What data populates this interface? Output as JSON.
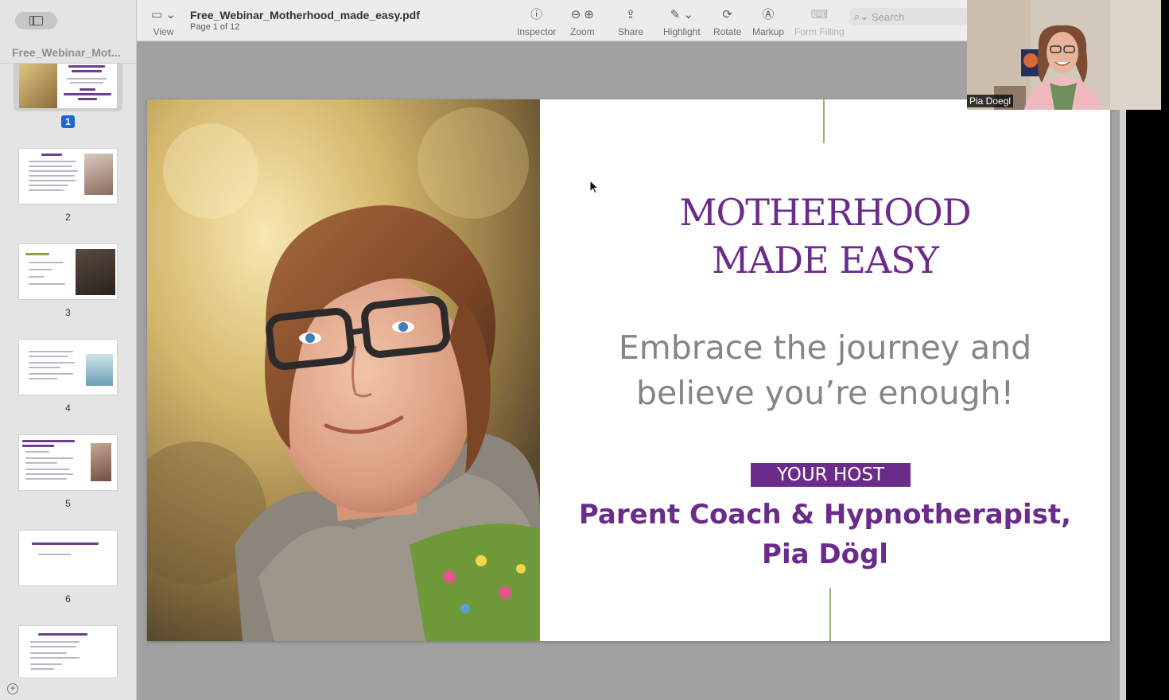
{
  "toolbar": {
    "view_label": "View",
    "doc_title": "Free_Webinar_Motherhood_made_easy.pdf",
    "page_info": "Page 1 of 12",
    "inspector_label": "Inspector",
    "zoom_label": "Zoom",
    "share_label": "Share",
    "highlight_label": "Highlight",
    "rotate_label": "Rotate",
    "markup_label": "Markup",
    "form_filling_label": "Form Filling",
    "search_placeholder": "Search"
  },
  "sidebar": {
    "title": "Free_Webinar_Mot...",
    "pages": [
      {
        "number": "1",
        "selected": true
      },
      {
        "number": "2"
      },
      {
        "number": "3"
      },
      {
        "number": "4"
      },
      {
        "number": "5"
      },
      {
        "number": "6"
      }
    ]
  },
  "slide": {
    "title_line1": "MOTHERHOOD",
    "title_line2": "MADE EASY",
    "tagline_line1": "Embrace the journey and",
    "tagline_line2": "believe you’re enough!",
    "host_badge": "YOUR HOST",
    "host_line1": "Parent Coach & Hypnotherapist,",
    "host_line2": "Pia Dögl",
    "accent_color": "#6a2b8a",
    "tagline_color": "#858585",
    "line_color": "#9bb36f"
  },
  "video": {
    "participant_name": "Pia Doegl"
  }
}
